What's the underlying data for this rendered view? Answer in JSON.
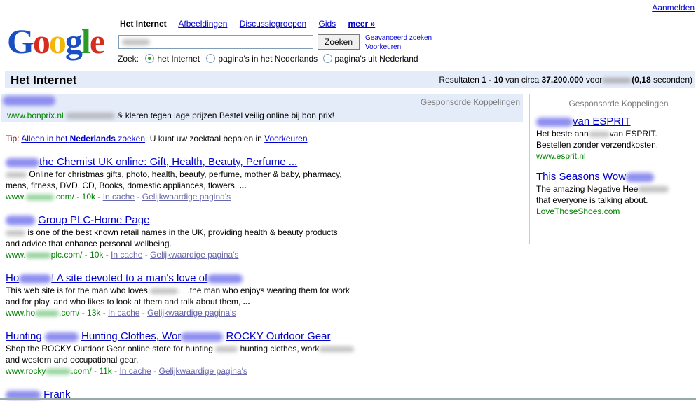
{
  "header": {
    "signin": "Aanmelden",
    "tabs": [
      {
        "label": "Het Internet",
        "current": true
      },
      {
        "label": "Afbeeldingen"
      },
      {
        "label": "Discussiegroepen"
      },
      {
        "label": "Gids"
      },
      {
        "label": "meer »"
      }
    ],
    "search_button": "Zoeken",
    "advanced": "Geavanceerd zoeken",
    "preferences": "Voorkeuren",
    "zoek_label": "Zoek:",
    "radio_options": [
      "het Internet",
      "pagina's in het Nederlands",
      "pagina's uit Nederland"
    ]
  },
  "logo": {
    "letters": [
      "G",
      "o",
      "o",
      "g",
      "l",
      "e"
    ],
    "colors": [
      "#1a4fc4",
      "#d62d20",
      "#f2b705",
      "#1a4fc4",
      "#2a9a2a",
      "#d62d20"
    ]
  },
  "bar": {
    "title": "Het Internet",
    "stats_prefix": "Resultaten ",
    "range_start": "1",
    "range_sep": " - ",
    "range_end": "10",
    "stats_mid": " van circa ",
    "count": "37.200.000",
    "stats_voor": " voor",
    "time": "0,18",
    "stats_suffix": " seconden)"
  },
  "sponsored_top": {
    "label": "Gesponsorde Koppelingen",
    "url": "www.bonprix.nl",
    "text": "& kleren tegen lage prijzen Bestel veilig online bij bon prix!"
  },
  "tip": {
    "label": "Tip:",
    "link": "Alleen in het",
    "bold": "Nederlands",
    "link_tail": "zoeken",
    "text": ". U kunt uw zoektaal bepalen in",
    "pref_link": "Voorkeuren"
  },
  "results": [
    {
      "title": "the Chemist UK online: Gift, Health, Beauty, Perfume ...",
      "snippet1": "Online for christmas gifts, photo, health, beauty, perfume, mother & baby, pharmacy,",
      "snippet2": "mens, fitness, DVD, CD, Books, domestic appliances, flowers,",
      "url_prefix": "www.",
      "url_suffix": ".com/ - 10k - "
    },
    {
      "title": "Group PLC-Home Page",
      "snippet1": "is one of the best known retail names in the UK, providing health & beauty products",
      "snippet2": "and advice that enhance personal wellbeing.",
      "url_prefix": "www.",
      "url_suffix": "plc.com/ - 10k - "
    },
    {
      "title": "! A site devoted to a man's love of",
      "title_prefix": "Ho",
      "snippet1": "This web site is for the man who loves",
      "snippet1_tail": ". . .the man who enjoys wearing them for work",
      "snippet2": "and for play, and who likes to look at them and talk about them,",
      "url_prefix": "www.ho",
      "url_suffix": ".com/ - 13k - "
    },
    {
      "title_prefix": "Hunting",
      "title_mid": "Hunting Clothes, Wor",
      "title_end": "ROCKY Outdoor Gear",
      "snippet1": "Shop the ROCKY Outdoor Gear online store for hunting",
      "snippet1_mid": "hunting clothes, work",
      "snippet2": "and western and occupational gear.",
      "url_prefix": "www.rocky",
      "url_suffix": ".com/ - 11k - "
    },
    {
      "title": "Frank"
    }
  ],
  "result_links": {
    "cache": "In cache",
    "similar": "Gelijkwaardige pagina's",
    "ellipsis": "..."
  },
  "right_ads": {
    "label": "Gesponsorde Koppelingen",
    "ads": [
      {
        "title": "van ESPRIT",
        "line1_a": "Het beste aan",
        "line1_b": "van ESPRIT.",
        "line2": "Bestellen zonder verzendkosten.",
        "url": "www.esprit.nl"
      },
      {
        "title": "This Seasons Wow",
        "line1": "The amazing Negative Hee",
        "line2": "that everyone is talking about.",
        "url": "LoveThoseShoes.com"
      }
    ]
  }
}
